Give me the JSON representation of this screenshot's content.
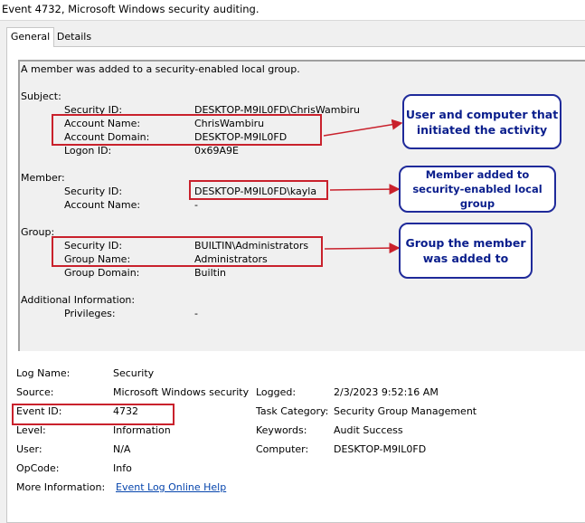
{
  "window": {
    "title": "Event 4732, Microsoft Windows security auditing."
  },
  "tabs": [
    {
      "label": "General"
    },
    {
      "label": "Details"
    }
  ],
  "description": {
    "headline": "A member was added to a security-enabled local group.",
    "subject": {
      "heading": "Subject:",
      "security_id_label": "Security ID:",
      "security_id": "DESKTOP-M9IL0FD\\ChrisWambiru",
      "account_name_label": "Account Name:",
      "account_name": "ChrisWambiru",
      "account_domain_label": "Account Domain:",
      "account_domain": "DESKTOP-M9IL0FD",
      "logon_id_label": "Logon ID:",
      "logon_id": "0x69A9E"
    },
    "member": {
      "heading": "Member:",
      "security_id_label": "Security ID:",
      "security_id": "DESKTOP-M9IL0FD\\kayla",
      "account_name_label": "Account Name:",
      "account_name": "-"
    },
    "group": {
      "heading": "Group:",
      "security_id_label": "Security ID:",
      "security_id": "BUILTIN\\Administrators",
      "group_name_label": "Group Name:",
      "group_name": "Administrators",
      "group_domain_label": "Group Domain:",
      "group_domain": "Builtin"
    },
    "additional": {
      "heading": "Additional Information:",
      "privileges_label": "Privileges:",
      "privileges": "-"
    }
  },
  "details": {
    "log_name_label": "Log Name:",
    "log_name": "Security",
    "source_label": "Source:",
    "source": "Microsoft Windows security",
    "logged_label": "Logged:",
    "logged": "2/3/2023 9:52:16 AM",
    "event_id_label": "Event ID:",
    "event_id": "4732",
    "task_category_label": "Task Category:",
    "task_category": "Security Group Management",
    "level_label": "Level:",
    "level": "Information",
    "keywords_label": "Keywords:",
    "keywords": "Audit Success",
    "user_label": "User:",
    "user": "N/A",
    "computer_label": "Computer:",
    "computer": "DESKTOP-M9IL0FD",
    "opcode_label": "OpCode:",
    "opcode": "Info",
    "more_info_label": "More Information:",
    "more_info_link": "Event Log Online Help"
  },
  "annotations": {
    "callout_subject": "User and computer that initiated the activity",
    "callout_member": "Member added to security-enabled local group",
    "callout_group": "Group the member was added to",
    "highlight_color": "#c9212c",
    "callout_border_color": "#1f2a9a",
    "callout_text_color": "#0a1e8c"
  }
}
